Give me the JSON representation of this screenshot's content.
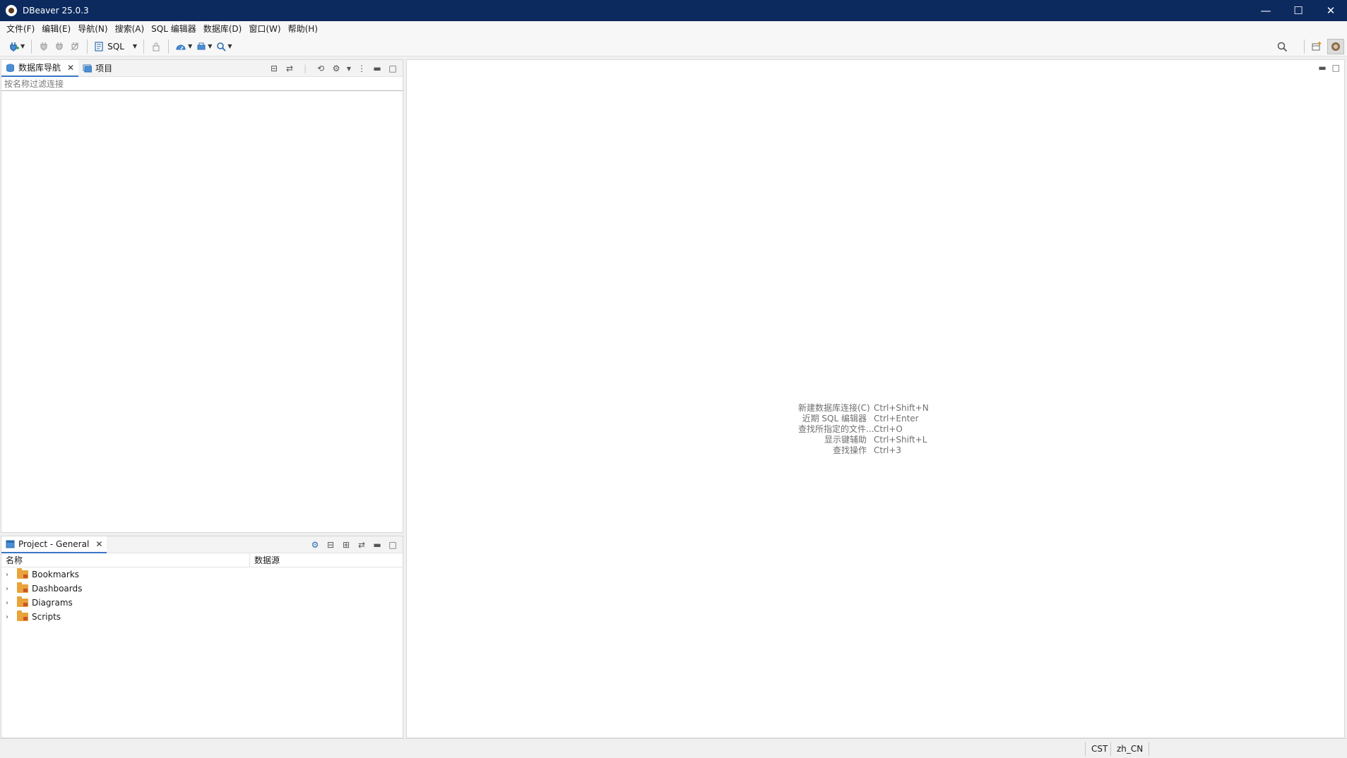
{
  "window": {
    "title": "DBeaver 25.0.3",
    "controls": {
      "minimize": "—",
      "maximize": "☐",
      "close": "✕"
    }
  },
  "menu": [
    {
      "label": "文件(F)"
    },
    {
      "label": "编辑(E)"
    },
    {
      "label": "导航(N)"
    },
    {
      "label": "搜索(A)"
    },
    {
      "label": "SQL 编辑器"
    },
    {
      "label": "数据库(D)"
    },
    {
      "label": "窗口(W)"
    },
    {
      "label": "帮助(H)"
    }
  ],
  "toolbar": {
    "sql_label": "SQL"
  },
  "navigator": {
    "tabs": [
      {
        "label": "数据库导航",
        "active": true
      },
      {
        "label": "项目",
        "active": false
      }
    ],
    "filter_placeholder": "按名称过滤连接"
  },
  "project": {
    "tab_label": "Project - General",
    "columns": [
      "名称",
      "数据源"
    ],
    "items": [
      {
        "label": "Bookmarks"
      },
      {
        "label": "Dashboards"
      },
      {
        "label": "Diagrams"
      },
      {
        "label": "Scripts"
      }
    ]
  },
  "editor": {
    "hints": [
      {
        "label": "新建数据库连接(C)",
        "key": "Ctrl+Shift+N"
      },
      {
        "label": "近期 SQL 编辑器",
        "key": "Ctrl+Enter"
      },
      {
        "label": "查找所指定的文件...",
        "key": "Ctrl+O"
      },
      {
        "label": "显示键辅助",
        "key": "Ctrl+Shift+L"
      },
      {
        "label": "查找操作",
        "key": "Ctrl+3"
      }
    ]
  },
  "status": {
    "timezone": "CST",
    "locale": "zh_CN"
  }
}
